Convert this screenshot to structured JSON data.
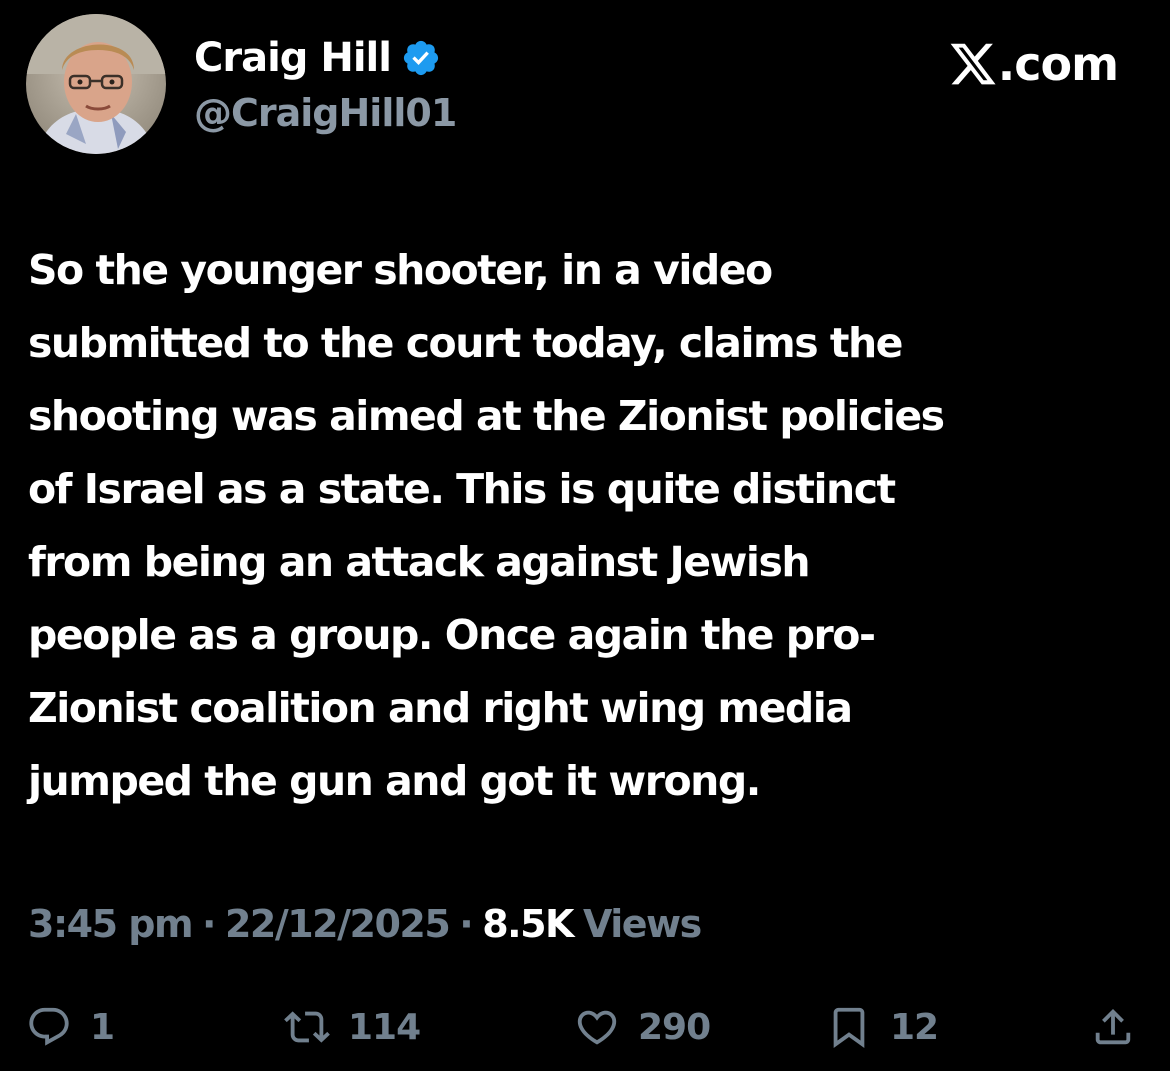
{
  "author": {
    "display_name": "Craig Hill",
    "handle": "@CraigHill01",
    "verified": true,
    "verified_color": "#1d9bf0",
    "avatar": "profile-photo"
  },
  "brand": {
    "icon": "x-logo-icon",
    "text": ".com"
  },
  "tweet": {
    "text": "So the younger shooter, in a video\nsubmitted to the court today, claims the\nshooting was aimed at the Zionist policies\nof Israel as a state. This is quite distinct\nfrom being an attack against Jewish\npeople as a group. Once again the pro-\nZionist coalition and right wing media\njumped the gun and got it wrong."
  },
  "meta": {
    "time": "3:45 pm",
    "separator": "·",
    "date": "22/12/2025",
    "views_count": "8.5K",
    "views_label": "Views"
  },
  "actions": {
    "reply": {
      "icon": "reply-icon",
      "count": "1"
    },
    "repost": {
      "icon": "repost-icon",
      "count": "114"
    },
    "like": {
      "icon": "heart-icon",
      "count": "290"
    },
    "bookmark": {
      "icon": "bookmark-icon",
      "count": "12"
    },
    "share": {
      "icon": "share-icon"
    }
  },
  "colors": {
    "background": "#000000",
    "text_primary": "#ffffff",
    "text_secondary": "#71808e"
  }
}
